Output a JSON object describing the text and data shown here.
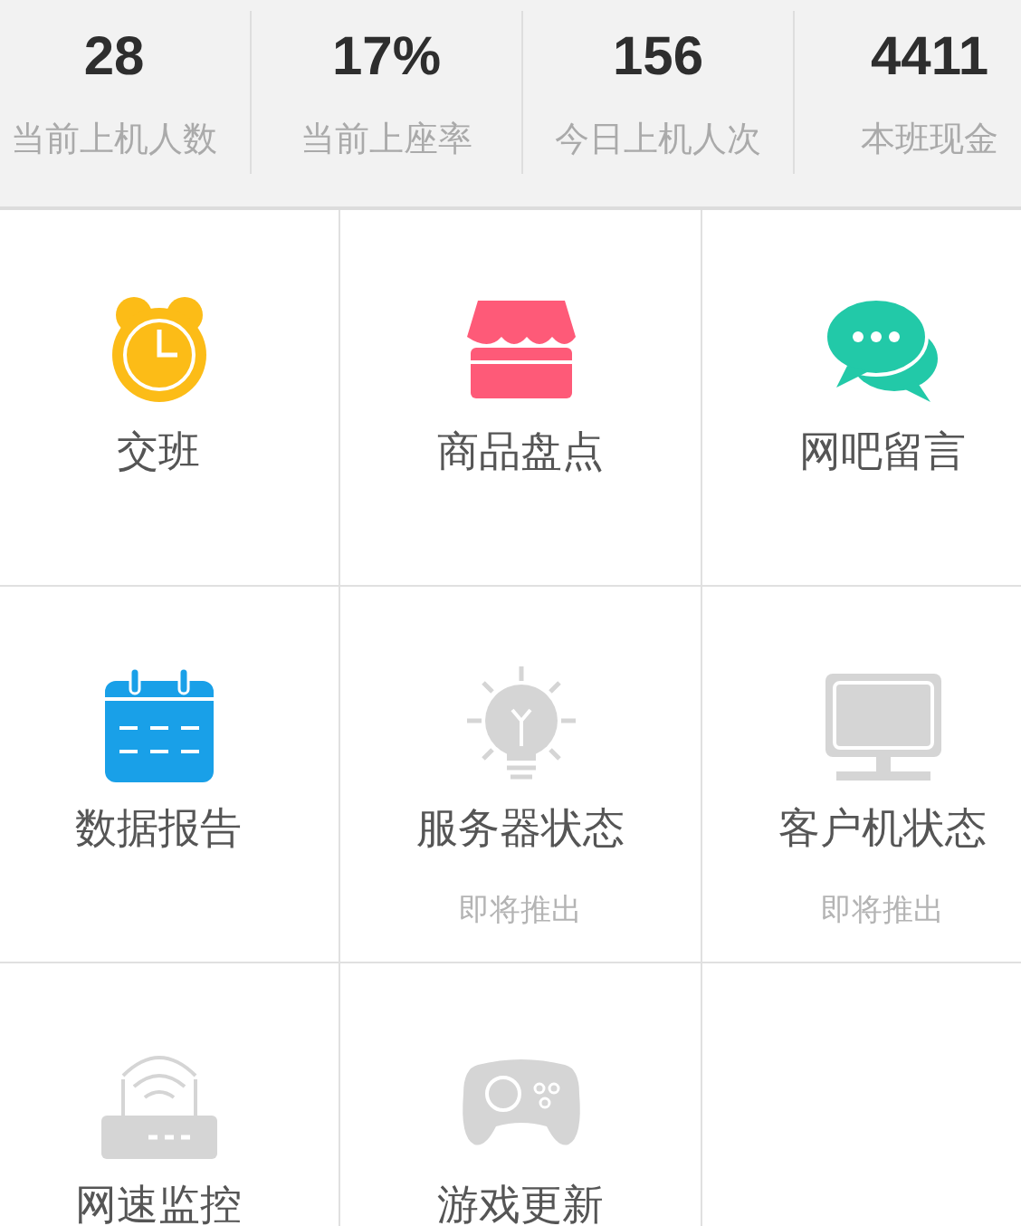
{
  "stats": [
    {
      "value": "28",
      "label": "当前上机人数"
    },
    {
      "value": "17%",
      "label": "当前上座率"
    },
    {
      "value": "156",
      "label": "今日上机人次"
    },
    {
      "value": "4411",
      "label": "本班现金"
    }
  ],
  "tiles": [
    {
      "label": "交班",
      "disabled": false
    },
    {
      "label": "商品盘点",
      "disabled": false
    },
    {
      "label": "网吧留言",
      "disabled": false
    },
    {
      "label": "数据报告",
      "disabled": false
    },
    {
      "label": "服务器状态",
      "disabled": true,
      "note": "即将推出"
    },
    {
      "label": "客户机状态",
      "disabled": true,
      "note": "即将推出"
    },
    {
      "label": "网速监控",
      "disabled": true
    },
    {
      "label": "游戏更新",
      "disabled": true
    }
  ]
}
